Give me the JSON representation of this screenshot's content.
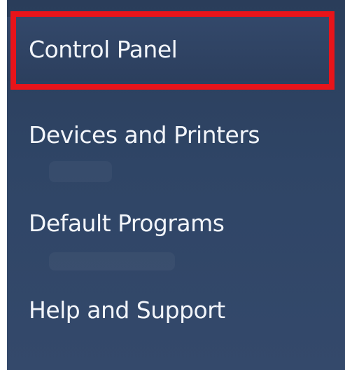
{
  "start_menu": {
    "items": [
      {
        "label": "Control Panel",
        "selected": true
      },
      {
        "label": "Devices and Printers"
      },
      {
        "label": "Default Programs"
      },
      {
        "label": "Help and Support"
      }
    ],
    "highlight_color": "#e8141a",
    "background_color": "#2f4566"
  }
}
